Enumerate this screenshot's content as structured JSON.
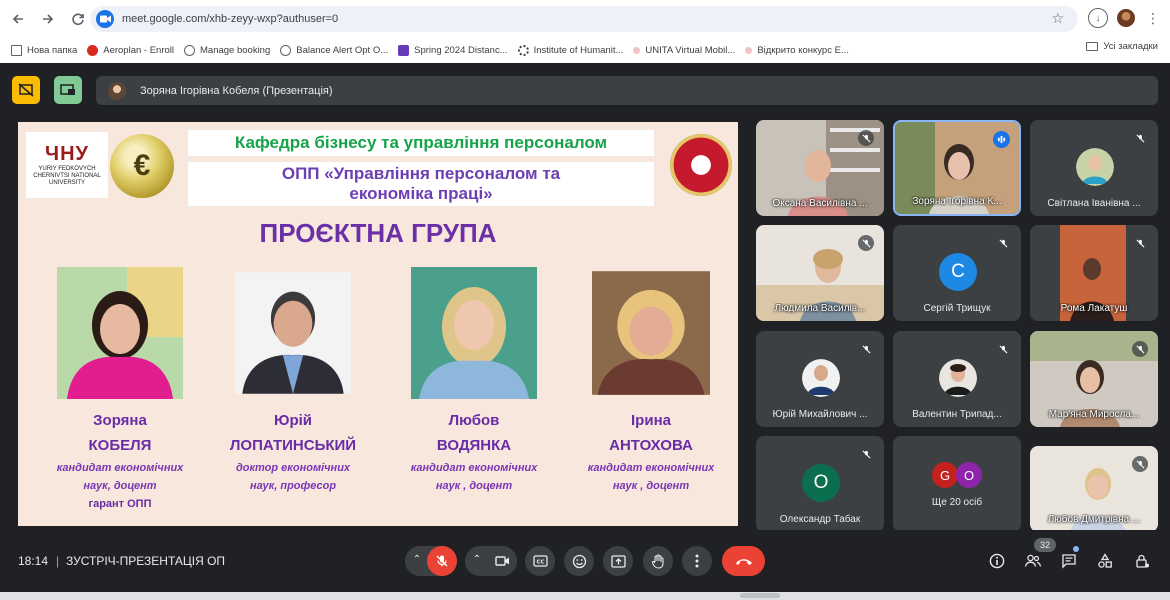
{
  "browser": {
    "url": "meet.google.com/xhb-zeyy-wxp?authuser=0",
    "bookmarks": [
      {
        "label": "Нова папка",
        "icon": "folder-icon"
      },
      {
        "label": "Aeroplan - Enroll",
        "icon": "aeroplan-icon"
      },
      {
        "label": "Manage booking",
        "icon": "globe-icon"
      },
      {
        "label": "Balance Alert Opt O...",
        "icon": "globe-icon"
      },
      {
        "label": "Spring 2024 Distanc...",
        "icon": "form-icon"
      },
      {
        "label": "Institute of Humanit...",
        "icon": "spinner-icon"
      },
      {
        "label": "UNITA Virtual Mobil...",
        "icon": "dot-icon"
      },
      {
        "label": "Відкрито конкурс E...",
        "icon": "dot-icon"
      }
    ],
    "all_bookmarks": "Усі закладки"
  },
  "meet": {
    "presenter_label": "Зоряна Ігорівна Кобеля (Презентація)",
    "time": "18:14",
    "separator": "|",
    "meeting_title": "ЗУСТРІЧ-ПРЕЗЕНТАЦІЯ ОП",
    "participant_count": "32"
  },
  "slide": {
    "chnu_mark": "ЧНУ",
    "chnu_text": "YURIY FEDKOVYCH CHERNIVTSI NATIONAL UNIVERSITY",
    "department": "Кафедра бізнесу та управління персоналом",
    "program_line1": "ОПП «Управління персоналом та",
    "program_line2": "економіка праці»",
    "heading": "ПРОЄКТНА ГРУПА",
    "people": [
      {
        "first": "Зоряна",
        "last": "КОБЕЛЯ",
        "degree1": "кандидат економічних",
        "degree2": "наук, доцент",
        "role": "гарант ОПП"
      },
      {
        "first": "Юрій",
        "last": "ЛОПАТИНСЬКИЙ",
        "degree1": "доктор економічних",
        "degree2": "наук, професор",
        "role": ""
      },
      {
        "first": "Любов",
        "last": "ВОДЯНКА",
        "degree1": "кандидат економічних",
        "degree2": "наук , доцент",
        "role": ""
      },
      {
        "first": "Ірина",
        "last": "АНТОХОВА",
        "degree1": "кандидат економічних",
        "degree2": "наук , доцент",
        "role": ""
      }
    ]
  },
  "participants": [
    {
      "name": "Оксана Василівна ...",
      "kind": "video",
      "muted": true
    },
    {
      "name": "Зоряна Ігорівна К...",
      "kind": "video",
      "speaking": true
    },
    {
      "name": "Світлана Іванівна ...",
      "kind": "photo",
      "muted": true
    },
    {
      "name": "Людмила Василів...",
      "kind": "video",
      "muted": true
    },
    {
      "name": "Сергій Трищук",
      "kind": "letter",
      "letter": "С",
      "color": "#1e88e5",
      "muted": true
    },
    {
      "name": "Рома Лакатуш",
      "kind": "video",
      "muted": true
    },
    {
      "name": "Юрій Михайлович ...",
      "kind": "photo",
      "muted": true
    },
    {
      "name": "Валентин Трипад...",
      "kind": "photo",
      "muted": true
    },
    {
      "name": "Мар'яна Миросла...",
      "kind": "video",
      "muted": true
    },
    {
      "name": "Олександр Табак",
      "kind": "letter",
      "letter": "О",
      "color": "#0b6e4f",
      "muted": true
    },
    {
      "name": "Ще 20 осіб",
      "kind": "more",
      "letters": [
        "G",
        "O"
      ],
      "colors": [
        "#c5221f",
        "#8e24aa"
      ]
    },
    {
      "name": "Любов Дмитрівна ...",
      "kind": "video",
      "muted": true
    }
  ],
  "colors": {
    "meet_bg": "#202124",
    "tile_bg": "#3c4043",
    "leave_red": "#ea4335",
    "accent_blue": "#1a73e8",
    "slide_purple": "#6b2fa8",
    "slide_green": "#17a34a"
  }
}
